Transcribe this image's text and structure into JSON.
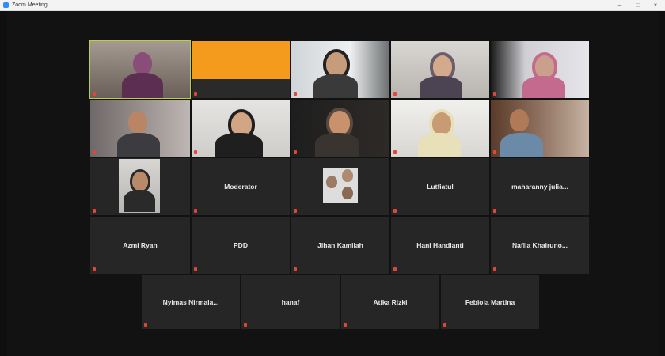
{
  "window": {
    "title": "Zoom Meeting",
    "minimize": "–",
    "maximize": "□",
    "close": "×"
  },
  "colors": {
    "active_speaker": "#b8d23c",
    "mic_muted": "#e0473c",
    "tile_background": "#202020"
  },
  "participants": {
    "p1": {
      "name": "Moderator"
    },
    "p2": {
      "name": "Lutfiatul"
    },
    "p3": {
      "name": "maharanny  julia..."
    },
    "p4": {
      "name": "Azmi Ryan"
    },
    "p5": {
      "name": "PDD"
    },
    "p6": {
      "name": "Jihan Kamilah"
    },
    "p7": {
      "name": "Hani Handianti"
    },
    "p8": {
      "name": "Naflla  Khairuno..."
    },
    "p9": {
      "name": "Nyimas  Nirmala..."
    },
    "p10": {
      "name": "hanaf"
    },
    "p11": {
      "name": "Atika Rizki"
    },
    "p12": {
      "name": "Febiola Martina"
    }
  }
}
